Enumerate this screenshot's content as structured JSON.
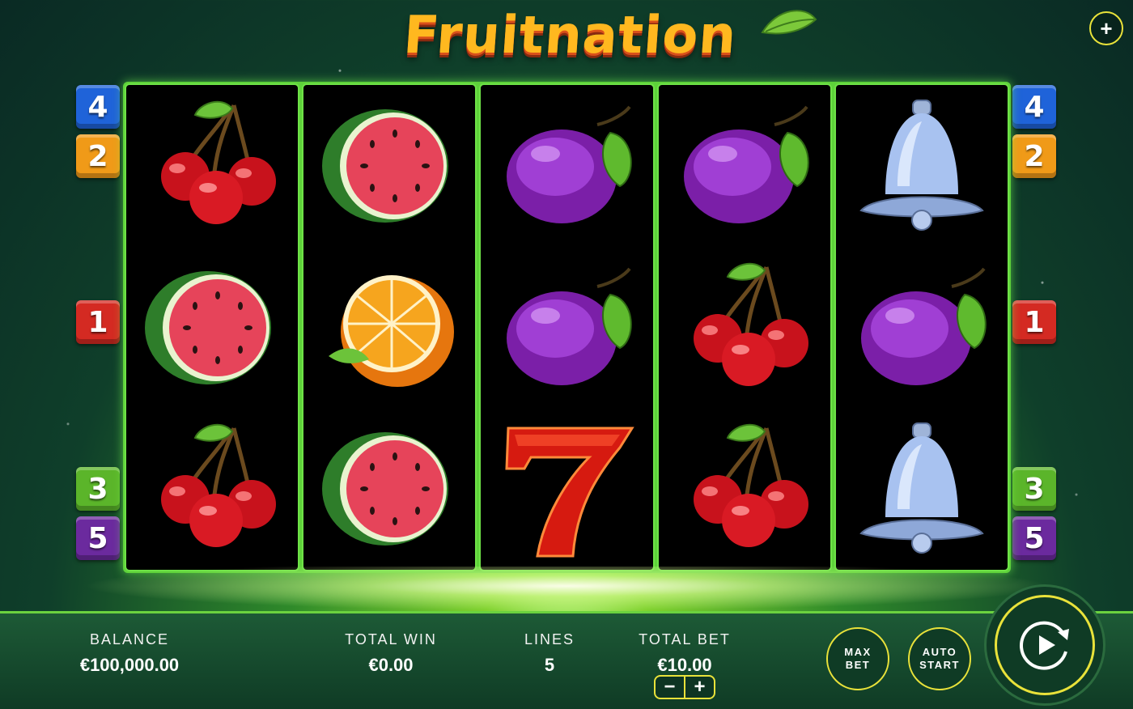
{
  "game": {
    "title": "Fruitnation"
  },
  "controls": {
    "menu_icon": "plus-icon",
    "plus_label": "+",
    "max_bet_line1": "MAX",
    "max_bet_line2": "BET",
    "auto_start_line1": "AUTO",
    "auto_start_line2": "START",
    "decrease_label": "−",
    "increase_label": "+",
    "spin_icon": "spin-icon"
  },
  "stats": {
    "balance_label": "BALANCE",
    "balance_value": "€100,000.00",
    "total_win_label": "TOTAL WIN",
    "total_win_value": "€0.00",
    "lines_label": "LINES",
    "lines_value": "5",
    "total_bet_label": "TOTAL BET",
    "total_bet_value": "€10.00"
  },
  "paylines": {
    "left": [
      "4",
      "2",
      "1",
      "3",
      "5"
    ],
    "right": [
      "4",
      "2",
      "1",
      "3",
      "5"
    ]
  },
  "reels": [
    [
      "cherry",
      "watermelon",
      "cherry"
    ],
    [
      "watermelon",
      "orange",
      "watermelon"
    ],
    [
      "plum",
      "plum",
      "seven"
    ],
    [
      "plum",
      "cherry",
      "cherry"
    ],
    [
      "bell",
      "plum",
      "bell"
    ]
  ],
  "colors": {
    "accent_yellow": "#e9e23a",
    "reel_border": "#6ee247",
    "line_4": "#1f63d9",
    "line_2": "#f09a18",
    "line_1": "#d42a22",
    "line_3": "#5bb52a",
    "line_5": "#6b2a9e"
  }
}
